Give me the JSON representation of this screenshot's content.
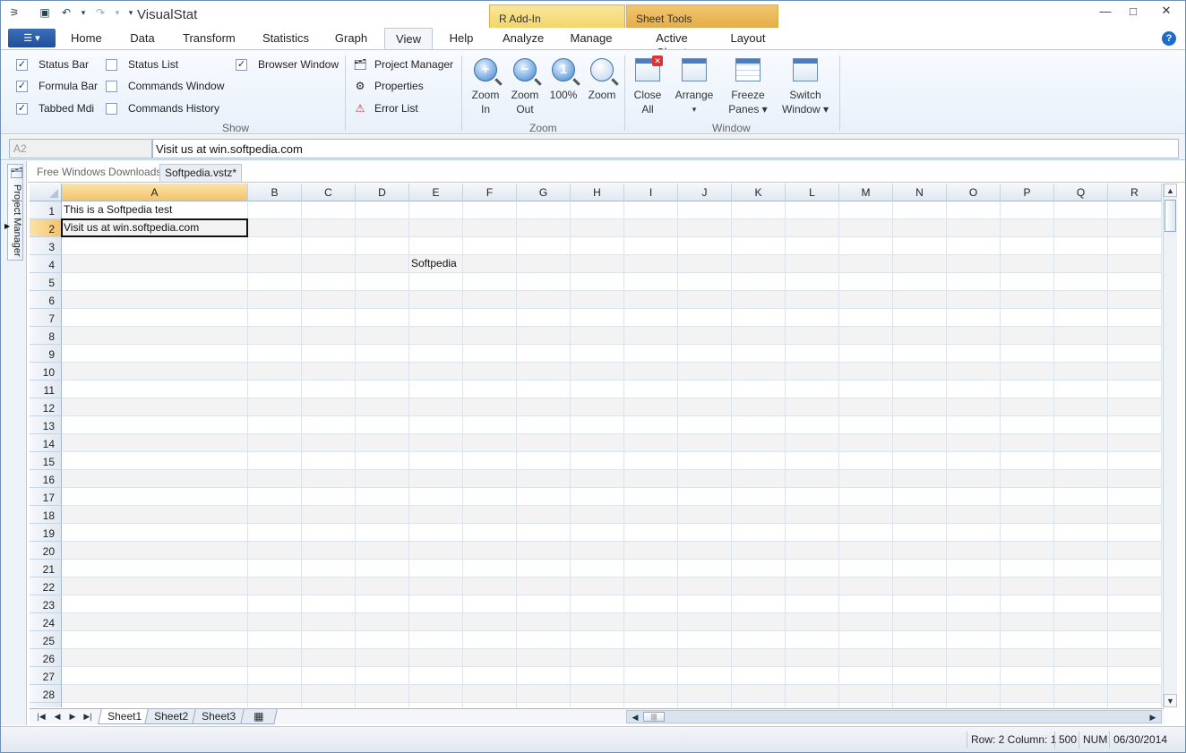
{
  "window": {
    "title": "VisualStat",
    "contextual_tabs": [
      "R Add-In",
      "Sheet Tools"
    ],
    "minimize": "—",
    "maximize": "□",
    "close": "✕"
  },
  "quick_access": {
    "app_icon": "⚞",
    "save": "▣",
    "undo": "↶",
    "undo_drop": "▾",
    "redo": "↷",
    "redo_drop": "▾",
    "customize": "▾"
  },
  "file_button": "☰ ▾",
  "tabs": [
    "Home",
    "Data",
    "Transform",
    "Statistics",
    "Graph",
    "View",
    "Help",
    "Analyze",
    "Manage",
    "Active Sheet",
    "Layout"
  ],
  "active_tab": "View",
  "help_icon": "?",
  "ribbon": {
    "show": {
      "label": "Show",
      "status_bar": "Status Bar",
      "formula_bar": "Formula Bar",
      "tabbed_mdi": "Tabbed Mdi",
      "status_list": "Status List",
      "commands_window": "Commands Window",
      "commands_history": "Commands History",
      "browser_window": "Browser Window",
      "project_manager": "Project Manager",
      "properties": "Properties",
      "error_list": "Error List",
      "checked": {
        "status_bar": true,
        "formula_bar": true,
        "tabbed_mdi": true,
        "status_list": false,
        "commands_window": false,
        "commands_history": false,
        "browser_window": true
      },
      "check_mark": "✓"
    },
    "zoom": {
      "label": "Zoom",
      "zoom_in_1": "Zoom",
      "zoom_in_2": "In",
      "zoom_out_1": "Zoom",
      "zoom_out_2": "Out",
      "zoom_100": "100%",
      "zoom": "Zoom",
      "glyph_in": "+",
      "glyph_out": "−",
      "glyph_100": "1"
    },
    "window": {
      "label": "Window",
      "close_all_1": "Close",
      "close_all_2": "All",
      "arrange": "Arrange",
      "arrange_arrow": "▾",
      "freeze_1": "Freeze",
      "freeze_2": "Panes ▾",
      "switch_1": "Switch",
      "switch_2": "Window ▾"
    }
  },
  "formula_bar": {
    "name_box": "A2",
    "formula": "Visit us at win.softpedia.com"
  },
  "project_manager_label": "Project Manager",
  "doc_tabs": [
    "Free Windows Downloads",
    "Softpedia.vstz*"
  ],
  "doc_close": "✕",
  "grid": {
    "columns": [
      "A",
      "B",
      "C",
      "D",
      "E",
      "F",
      "G",
      "H",
      "I",
      "J",
      "K",
      "L",
      "M",
      "N",
      "O",
      "P",
      "Q",
      "R"
    ],
    "rows": [
      "1",
      "2",
      "3",
      "4",
      "5",
      "6",
      "7",
      "8",
      "9",
      "10",
      "11",
      "12",
      "13",
      "14",
      "15",
      "16",
      "17",
      "18",
      "19",
      "20",
      "21",
      "22",
      "23",
      "24",
      "25",
      "26",
      "27",
      "28"
    ],
    "selected_column": "A",
    "selected_row": "2",
    "row_marker": "▶",
    "cells": {
      "A1": "This is a Softpedia test",
      "A2": "Visit us at win.softpedia.com",
      "E4": "Softpedia"
    }
  },
  "sheets": [
    "Sheet1",
    "Sheet2",
    "Sheet3"
  ],
  "active_sheet": "Sheet1",
  "sheet_nav": [
    "|◀",
    "◀",
    "▶",
    "▶|"
  ],
  "new_sheet_icon": "▦",
  "scroll": {
    "up": "▲",
    "down": "▼",
    "left": "◀",
    "right": "▶",
    "grip": "|||"
  },
  "status": {
    "position": "Row: 2 Column: 1",
    "count": "500",
    "num": "NUM",
    "date": "06/30/2014"
  }
}
